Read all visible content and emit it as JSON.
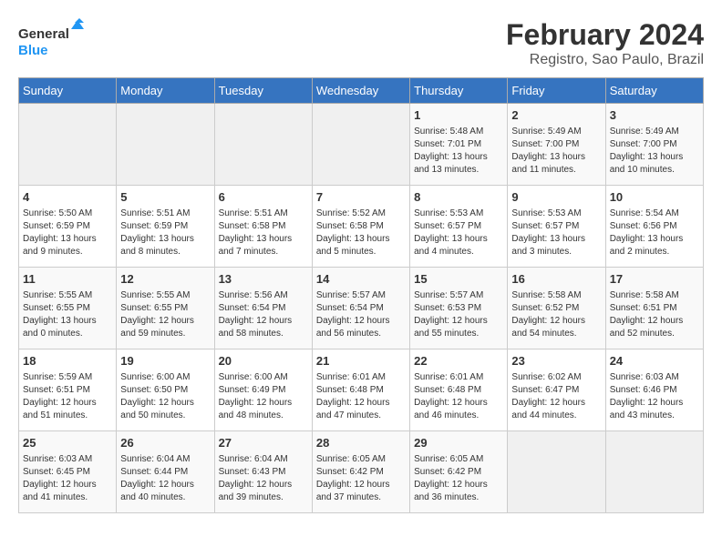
{
  "header": {
    "logo_line1": "General",
    "logo_line2": "Blue",
    "title": "February 2024",
    "subtitle": "Registro, Sao Paulo, Brazil"
  },
  "weekdays": [
    "Sunday",
    "Monday",
    "Tuesday",
    "Wednesday",
    "Thursday",
    "Friday",
    "Saturday"
  ],
  "weeks": [
    [
      {
        "day": "",
        "info": ""
      },
      {
        "day": "",
        "info": ""
      },
      {
        "day": "",
        "info": ""
      },
      {
        "day": "",
        "info": ""
      },
      {
        "day": "1",
        "info": "Sunrise: 5:48 AM\nSunset: 7:01 PM\nDaylight: 13 hours and 13 minutes."
      },
      {
        "day": "2",
        "info": "Sunrise: 5:49 AM\nSunset: 7:00 PM\nDaylight: 13 hours and 11 minutes."
      },
      {
        "day": "3",
        "info": "Sunrise: 5:49 AM\nSunset: 7:00 PM\nDaylight: 13 hours and 10 minutes."
      }
    ],
    [
      {
        "day": "4",
        "info": "Sunrise: 5:50 AM\nSunset: 6:59 PM\nDaylight: 13 hours and 9 minutes."
      },
      {
        "day": "5",
        "info": "Sunrise: 5:51 AM\nSunset: 6:59 PM\nDaylight: 13 hours and 8 minutes."
      },
      {
        "day": "6",
        "info": "Sunrise: 5:51 AM\nSunset: 6:58 PM\nDaylight: 13 hours and 7 minutes."
      },
      {
        "day": "7",
        "info": "Sunrise: 5:52 AM\nSunset: 6:58 PM\nDaylight: 13 hours and 5 minutes."
      },
      {
        "day": "8",
        "info": "Sunrise: 5:53 AM\nSunset: 6:57 PM\nDaylight: 13 hours and 4 minutes."
      },
      {
        "day": "9",
        "info": "Sunrise: 5:53 AM\nSunset: 6:57 PM\nDaylight: 13 hours and 3 minutes."
      },
      {
        "day": "10",
        "info": "Sunrise: 5:54 AM\nSunset: 6:56 PM\nDaylight: 13 hours and 2 minutes."
      }
    ],
    [
      {
        "day": "11",
        "info": "Sunrise: 5:55 AM\nSunset: 6:55 PM\nDaylight: 13 hours and 0 minutes."
      },
      {
        "day": "12",
        "info": "Sunrise: 5:55 AM\nSunset: 6:55 PM\nDaylight: 12 hours and 59 minutes."
      },
      {
        "day": "13",
        "info": "Sunrise: 5:56 AM\nSunset: 6:54 PM\nDaylight: 12 hours and 58 minutes."
      },
      {
        "day": "14",
        "info": "Sunrise: 5:57 AM\nSunset: 6:54 PM\nDaylight: 12 hours and 56 minutes."
      },
      {
        "day": "15",
        "info": "Sunrise: 5:57 AM\nSunset: 6:53 PM\nDaylight: 12 hours and 55 minutes."
      },
      {
        "day": "16",
        "info": "Sunrise: 5:58 AM\nSunset: 6:52 PM\nDaylight: 12 hours and 54 minutes."
      },
      {
        "day": "17",
        "info": "Sunrise: 5:58 AM\nSunset: 6:51 PM\nDaylight: 12 hours and 52 minutes."
      }
    ],
    [
      {
        "day": "18",
        "info": "Sunrise: 5:59 AM\nSunset: 6:51 PM\nDaylight: 12 hours and 51 minutes."
      },
      {
        "day": "19",
        "info": "Sunrise: 6:00 AM\nSunset: 6:50 PM\nDaylight: 12 hours and 50 minutes."
      },
      {
        "day": "20",
        "info": "Sunrise: 6:00 AM\nSunset: 6:49 PM\nDaylight: 12 hours and 48 minutes."
      },
      {
        "day": "21",
        "info": "Sunrise: 6:01 AM\nSunset: 6:48 PM\nDaylight: 12 hours and 47 minutes."
      },
      {
        "day": "22",
        "info": "Sunrise: 6:01 AM\nSunset: 6:48 PM\nDaylight: 12 hours and 46 minutes."
      },
      {
        "day": "23",
        "info": "Sunrise: 6:02 AM\nSunset: 6:47 PM\nDaylight: 12 hours and 44 minutes."
      },
      {
        "day": "24",
        "info": "Sunrise: 6:03 AM\nSunset: 6:46 PM\nDaylight: 12 hours and 43 minutes."
      }
    ],
    [
      {
        "day": "25",
        "info": "Sunrise: 6:03 AM\nSunset: 6:45 PM\nDaylight: 12 hours and 41 minutes."
      },
      {
        "day": "26",
        "info": "Sunrise: 6:04 AM\nSunset: 6:44 PM\nDaylight: 12 hours and 40 minutes."
      },
      {
        "day": "27",
        "info": "Sunrise: 6:04 AM\nSunset: 6:43 PM\nDaylight: 12 hours and 39 minutes."
      },
      {
        "day": "28",
        "info": "Sunrise: 6:05 AM\nSunset: 6:42 PM\nDaylight: 12 hours and 37 minutes."
      },
      {
        "day": "29",
        "info": "Sunrise: 6:05 AM\nSunset: 6:42 PM\nDaylight: 12 hours and 36 minutes."
      },
      {
        "day": "",
        "info": ""
      },
      {
        "day": "",
        "info": ""
      }
    ]
  ]
}
